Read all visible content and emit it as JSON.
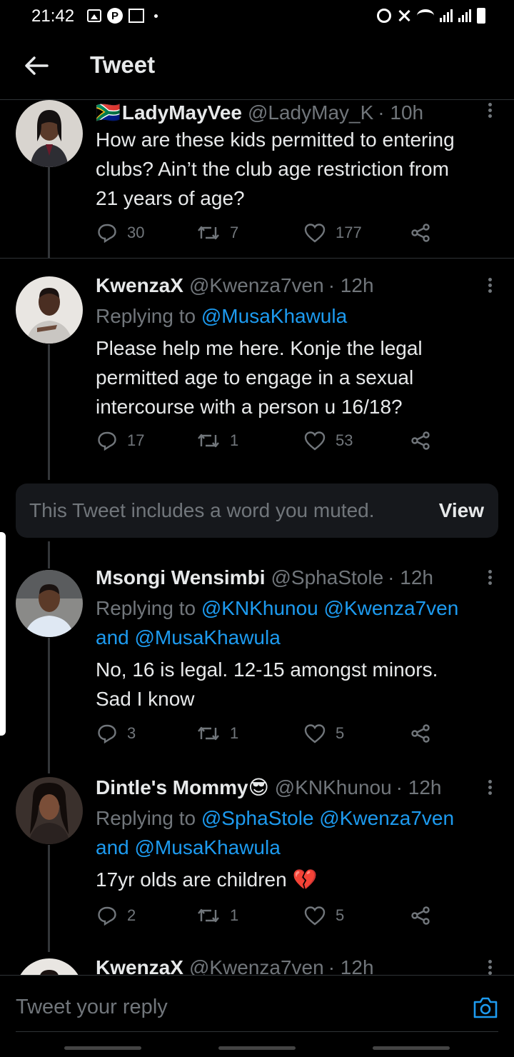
{
  "status_bar": {
    "time": "21:42",
    "app_badge": "P"
  },
  "header": {
    "title": "Tweet"
  },
  "tweets": [
    {
      "flag": "🇿🇦",
      "name": "LadyMayVee",
      "handle": "@LadyMay_K",
      "time": "· 10h",
      "replying_prefix": "",
      "mentions": [],
      "mention_joiner": "",
      "text_lines": [
        "How are these kids permitted to entering",
        "clubs? Ain’t the club age restriction from",
        "21 years of age?"
      ],
      "replies": "30",
      "retweets": "7",
      "likes": "177"
    },
    {
      "name": "KwenzaX",
      "handle": "@Kwenza7ven",
      "time": "· 12h",
      "replying_prefix": "Replying to",
      "mentions": [
        "@MusaKhawula"
      ],
      "text_lines": [
        "Please help me here. Konje the legal",
        "permitted age to engage in a sexual",
        "intercourse with a person u 16/18?"
      ],
      "replies": "17",
      "retweets": "1",
      "likes": "53"
    },
    {
      "name": "Msongi Wensimbi",
      "handle": "@SphaStole",
      "time": "· 12h",
      "replying_prefix": "Replying to",
      "mentions": [
        "@KNKhunou",
        "@Kwenza7ven",
        "@MusaKhawula"
      ],
      "mention_joiner": "and",
      "text_lines": [
        "No, 16 is legal. 12-15 amongst minors.",
        "Sad I know"
      ],
      "replies": "3",
      "retweets": "1",
      "likes": "5"
    },
    {
      "name": "Dintle's Mommy",
      "name_emoji": "😎",
      "handle": "@KNKhunou",
      "time": "· 12h",
      "replying_prefix": "Replying to",
      "mentions": [
        "@SphaStole",
        "@Kwenza7ven",
        "@MusaKhawula"
      ],
      "mention_joiner": "and",
      "text_lines": [
        "17yr olds are children"
      ],
      "text_emoji": "💔",
      "replies": "2",
      "retweets": "1",
      "likes": "5"
    },
    {
      "name": "KwenzaX",
      "handle": "@Kwenza7ven",
      "time": "· 12h"
    }
  ],
  "muted_notice": {
    "text": "This Tweet includes a word you muted.",
    "action": "View"
  },
  "reply_bar": {
    "placeholder": "Tweet your reply"
  },
  "colors": {
    "background": "#000000",
    "text": "#e7e9ea",
    "secondary": "#71767b",
    "accent": "#1d9bf0",
    "heart_emoji": "#e0245e"
  }
}
